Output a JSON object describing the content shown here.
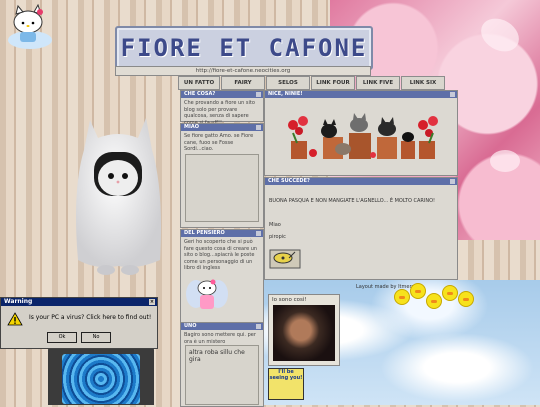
{
  "site": {
    "title": "FIORE ET CAFONE",
    "url": "http://fiore-et-cafone.neocities.org"
  },
  "nav": [
    "UN FATTO",
    "FAIRY",
    "SELOS",
    "LINK FOUR",
    "LINK FIVE",
    "LINK SIX"
  ],
  "panels": {
    "che_cosa": {
      "title": "CHE COSA?",
      "body": "Che provando a fiore un sito blog solo per provare qualcosa, senza di sapere come si fa uff!!"
    },
    "miao": {
      "title": "MIAO",
      "body": "Se fiore gatto Amo. se Fiore cane, fuoo se Fosse Sordi...ciao."
    },
    "del_pensiero": {
      "title": "DEL PENSIERO",
      "body": "Geri ho scoperto che si può fare questo cosa di creare un sito o blog...spiacrà le poste come un personaggio di un libro di ingless"
    },
    "uno": {
      "title": "UNO",
      "body": "Bagiro sono mettere qui. per ora è un mistero",
      "quote": "altra roba sillu che gira"
    },
    "nice": {
      "title": "NICE, NINIE!"
    },
    "che_succede": {
      "title": "CHE SUCCEDE?",
      "body": "BUONA PASQUA E NON MANGIATE L'AGNELLO... È MOLTO CARINO!",
      "sub1": "Miao",
      "sub2": "piropic"
    },
    "profile": {
      "credit": "Layout made by Itmeros",
      "heading": "Io sono così!",
      "badge": "I'll be seeing you!"
    }
  },
  "dialog": {
    "title": "Warning",
    "message": "Is your PC a virus? Click here to find out!",
    "ok": "Ok",
    "no": "No"
  },
  "colors": {
    "header": "#5e6fa8",
    "banner_text": "#3d4a8a",
    "dialog_title": "#0a246a"
  }
}
